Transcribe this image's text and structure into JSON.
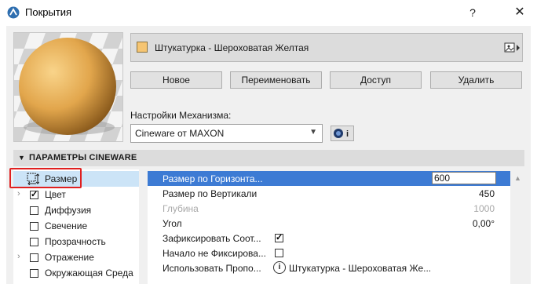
{
  "window": {
    "title": "Покрытия",
    "help_label": "?",
    "close_label": "✕"
  },
  "material": {
    "name": "Штукатурка - Шероховатая Желтая",
    "swatch_color": "#f6c572"
  },
  "buttons": {
    "new": "Новое",
    "rename": "Переименовать",
    "access": "Доступ",
    "delete": "Удалить"
  },
  "engine": {
    "label": "Настройки Механизма:",
    "value": "Cineware от MAXON",
    "info_label": "i"
  },
  "section": {
    "title": "ПАРАМЕТРЫ CINEWARE"
  },
  "tree": [
    {
      "label": "Размер",
      "expander": "",
      "checkbox": false,
      "checked": false,
      "selected": true
    },
    {
      "label": "Цвет",
      "expander": "›",
      "checkbox": true,
      "checked": true,
      "selected": false
    },
    {
      "label": "Диффузия",
      "expander": "",
      "checkbox": true,
      "checked": false,
      "selected": false
    },
    {
      "label": "Свечение",
      "expander": "",
      "checkbox": true,
      "checked": false,
      "selected": false
    },
    {
      "label": "Прозрачность",
      "expander": "",
      "checkbox": true,
      "checked": false,
      "selected": false
    },
    {
      "label": "Отражение",
      "expander": "›",
      "checkbox": true,
      "checked": false,
      "selected": false
    },
    {
      "label": "Окружающая Среда",
      "expander": "",
      "checkbox": true,
      "checked": false,
      "selected": false
    }
  ],
  "properties": {
    "horizontal": {
      "label": "Размер по Горизонта...",
      "value": "600"
    },
    "vertical": {
      "label": "Размер по Вертикали",
      "value": "450"
    },
    "depth": {
      "label": "Глубина",
      "value": "1000"
    },
    "angle": {
      "label": "Угол",
      "value": "0,00°"
    },
    "lock_ratio": {
      "label": "Зафиксировать Соот...",
      "checked": true
    },
    "start_unfixed": {
      "label": "Начало не Фиксирова...",
      "checked": false
    },
    "use_props": {
      "label": "Использовать Пропо...",
      "info_label": "i",
      "value": "Штукатурка - Шероховатая Же..."
    }
  }
}
